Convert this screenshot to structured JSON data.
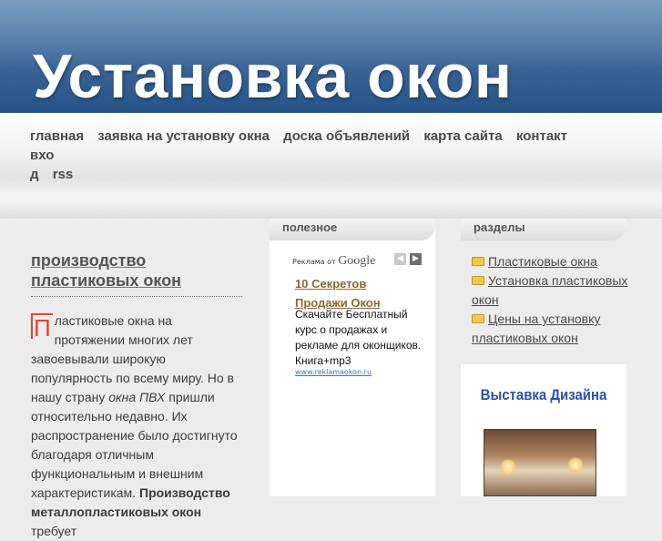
{
  "header": {
    "title": "Установка окон"
  },
  "nav": {
    "items": [
      "главная",
      "заявка на установку окна",
      "доска объявлений",
      "карта сайта",
      "контакт",
      "вхо",
      "д",
      "rss"
    ]
  },
  "post": {
    "title": "производство пластиковых окон",
    "dropcap": "П",
    "body_part1": "ластиковые окна на протяжении многих лет завоевывали широкую популярность по всему миру. Но в нашу страну ",
    "body_em": "окна ПВХ",
    "body_part2": " пришли относительно недавно. Их распространение было достигнуто благодаря отличным функциональным и внешним характеристикам. ",
    "body_strong": "Производство металлопластиковых окон",
    "body_part3": " требует"
  },
  "middle": {
    "heading": "полезное",
    "ad": {
      "label_prefix": "Реклама от",
      "label_brand": "Google",
      "title": "10 Секретов Продажи Окон",
      "text": "Скачайте Бесплатный курс о продажах и рекламе для оконщиков. Книга+mp3",
      "url": "www.reklamaokon.ru"
    }
  },
  "right": {
    "heading": "разделы",
    "categories": [
      "Пластиковые окна",
      "Установка пластиковых окон",
      "Цены на установку пластиковых окон"
    ],
    "banner_title": "Выставка Дизайна"
  },
  "colors": {
    "header_blue": "#3d6697",
    "dropcap_red": "#e8442b",
    "banner_blue": "#2a4fb8",
    "ad_link": "#8a6a2e"
  }
}
